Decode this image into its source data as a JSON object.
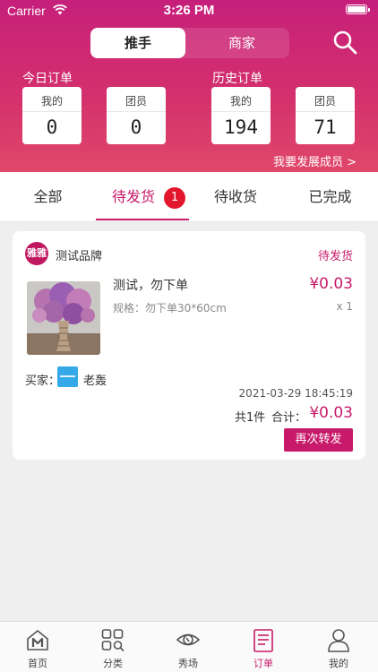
{
  "status_bar": {
    "carrier": "Carrier",
    "time": "3:26 PM"
  },
  "header": {
    "segment": {
      "active": "推手",
      "inactive": "商家"
    },
    "today": {
      "title": "今日订单",
      "cards": [
        {
          "label": "我的",
          "value": "0"
        },
        {
          "label": "团员",
          "value": "0"
        }
      ]
    },
    "history": {
      "title": "历史订单",
      "cards": [
        {
          "label": "我的",
          "value": "194"
        },
        {
          "label": "团员",
          "value": "71"
        }
      ]
    },
    "grow_link": "我要发展成员 >",
    "colors": {
      "gradient_top": "#c61f7b",
      "gradient_bottom": "#e04869"
    }
  },
  "tabs": {
    "items": [
      {
        "label": "全部"
      },
      {
        "label": "待发货",
        "badge": "1"
      },
      {
        "label": "待收货"
      },
      {
        "label": "已完成"
      }
    ],
    "active_index": 1
  },
  "order": {
    "brand_logo_text": "雅雅",
    "brand_name": "测试品牌",
    "status": "待发货",
    "product_title": "测试，勿下单",
    "spec": "规格：勿下单30*60cm",
    "price": "¥0.03",
    "qty": "x 1",
    "buyer_label": "买家：",
    "buyer_name": "老轰",
    "time": "2021-03-29 18:45:19",
    "total_count": "共1件",
    "total_label": "合计：",
    "total_price": "¥0.03",
    "reship_button": "再次转发"
  },
  "bottom_nav": {
    "items": [
      {
        "label": "首页",
        "icon": "home-icon"
      },
      {
        "label": "分类",
        "icon": "category-icon"
      },
      {
        "label": "秀场",
        "icon": "eye-icon"
      },
      {
        "label": "订单",
        "icon": "order-icon"
      },
      {
        "label": "我的",
        "icon": "profile-icon"
      }
    ],
    "active_index": 3
  },
  "accent_color": "#c81a6a"
}
